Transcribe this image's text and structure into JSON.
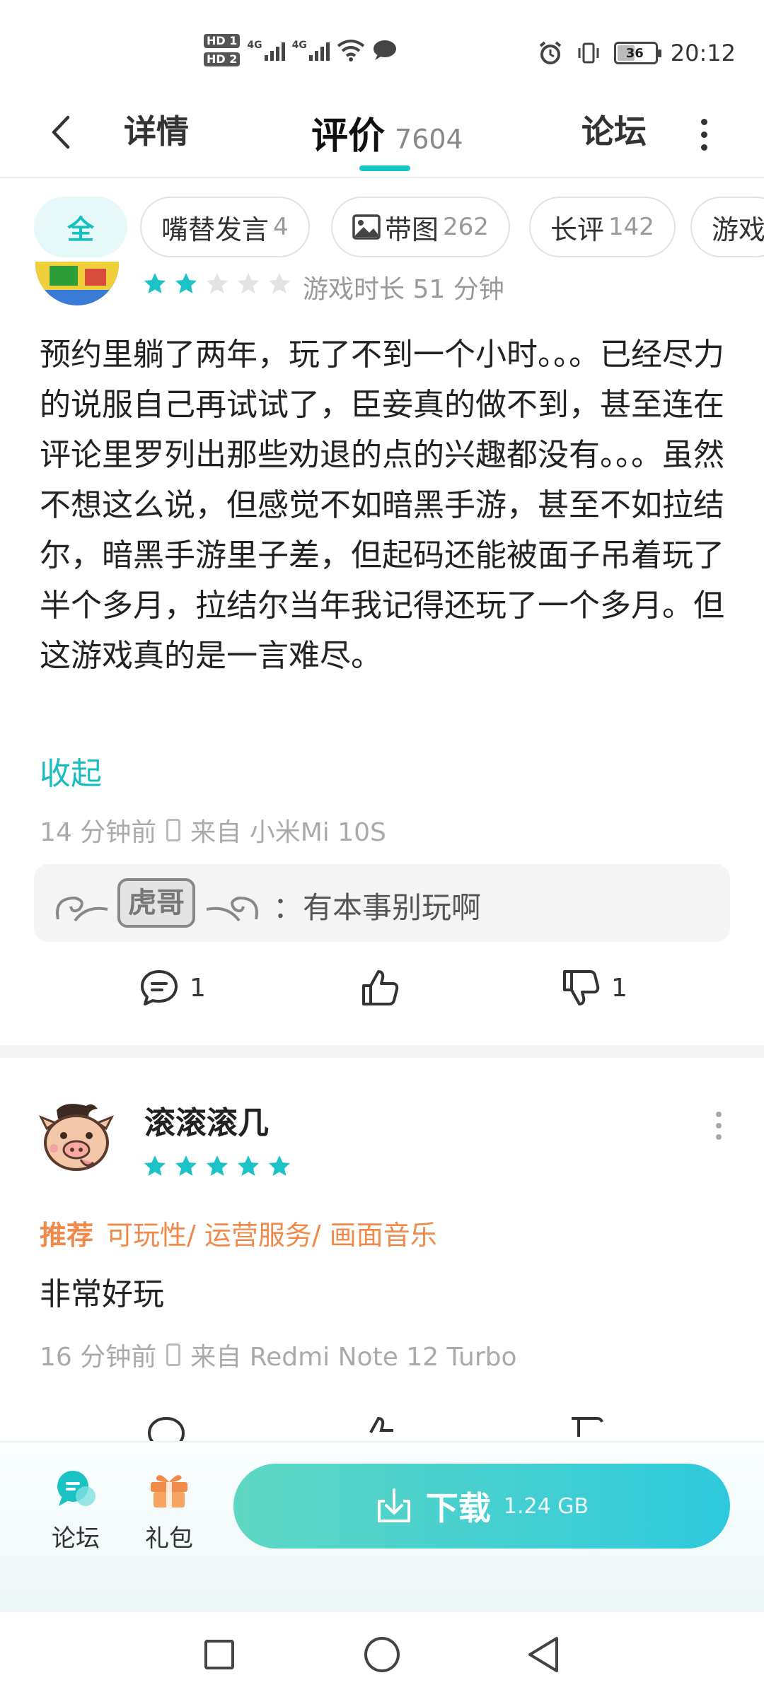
{
  "status_bar": {
    "hd1": "HD 1",
    "hd2": "HD 2",
    "net1": "4G",
    "net2": "4G",
    "battery": "36",
    "time": "20:12"
  },
  "nav": {
    "detail": "详情",
    "review": "评价",
    "review_count": "7604",
    "forum": "论坛"
  },
  "chips": [
    {
      "label": "全",
      "count": ""
    },
    {
      "label": "嘴替发言",
      "count": "4"
    },
    {
      "label": "带图",
      "count": "262"
    },
    {
      "label": "长评",
      "count": "142"
    },
    {
      "label": "游戏",
      "count": ""
    }
  ],
  "review1": {
    "rating": 2,
    "playtime": "游戏时长 51 分钟",
    "text": "预约里躺了两年，玩了不到一个小时。。。已经尽力的说服自己再试试了，臣妾真的做不到，甚至连在评论里罗列出那些劝退的点的兴趣都没有。。。虽然不想这么说，但感觉不如暗黑手游，甚至不如拉结尔，暗黑手游里子差，但起码还能被面子吊着玩了半个多月，拉结尔当年我记得还玩了一个多月。但这游戏真的是一言难尽。",
    "collapse": "收起",
    "time_ago": "14 分钟前",
    "device": "来自 小米Mi 10S",
    "reply_badge": "虎哥",
    "reply_text": "：有本事别玩啊",
    "comment_count": "1",
    "dislike_count": "1"
  },
  "review2": {
    "username": "滚滚滚几",
    "rating": 5,
    "recommend_label": "推荐",
    "tags": "可玩性/ 运营服务/ 画面音乐",
    "text": "非常好玩",
    "time_ago": "16 分钟前",
    "device": "来自 Redmi Note 12 Turbo"
  },
  "bottom": {
    "forum": "论坛",
    "gift": "礼包",
    "download": "下载",
    "size": "1.24 GB"
  },
  "colors": {
    "accent": "#16c5c7",
    "recommend": "#f08a4b",
    "star_on": "#1cc3c6",
    "star_off": "#e3e3e3"
  }
}
